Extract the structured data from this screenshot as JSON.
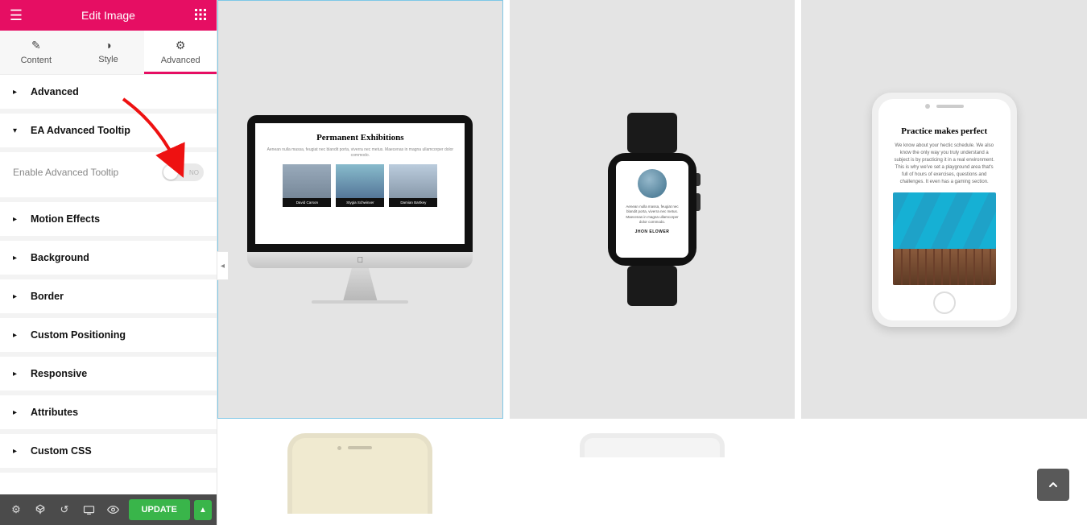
{
  "header": {
    "title": "Edit Image"
  },
  "tabs": {
    "content": "Content",
    "style": "Style",
    "advanced": "Advanced"
  },
  "sections": {
    "advanced": "Advanced",
    "ea_tooltip": "EA Advanced Tooltip",
    "enable_label": "Enable Advanced Tooltip",
    "toggle_state": "NO",
    "motion": "Motion Effects",
    "background": "Background",
    "border": "Border",
    "custom_positioning": "Custom Positioning",
    "responsive": "Responsive",
    "attributes": "Attributes",
    "custom_css": "Custom CSS"
  },
  "footer": {
    "update": "UPDATE"
  },
  "canvas": {
    "imac": {
      "title": "Permanent Exhibitions",
      "blurb": "Aenean nulla massa, feugiat nec blandit porta, viverra nec metus. Maecenas in magna ullamcorper dolor commodo.",
      "exhibits": [
        "David Carson",
        "Stygia Schwinxer",
        "Damian Bartkey"
      ]
    },
    "watch": {
      "blurb": "Aenean nulla massa, feugiat nec blandit porta, viverra nec metus. Maecenas in magna ullamcorper dolor commodo.",
      "name": "JHON ELOWER"
    },
    "phone": {
      "title": "Practice makes perfect",
      "body": "We know about your hectic schedule. We also know the only way you truly understand a subject is by practicing it in a real environment. This is why we've set a playground area that's full of hours of exercises, questions and challenges. It even has a gaming section."
    }
  }
}
